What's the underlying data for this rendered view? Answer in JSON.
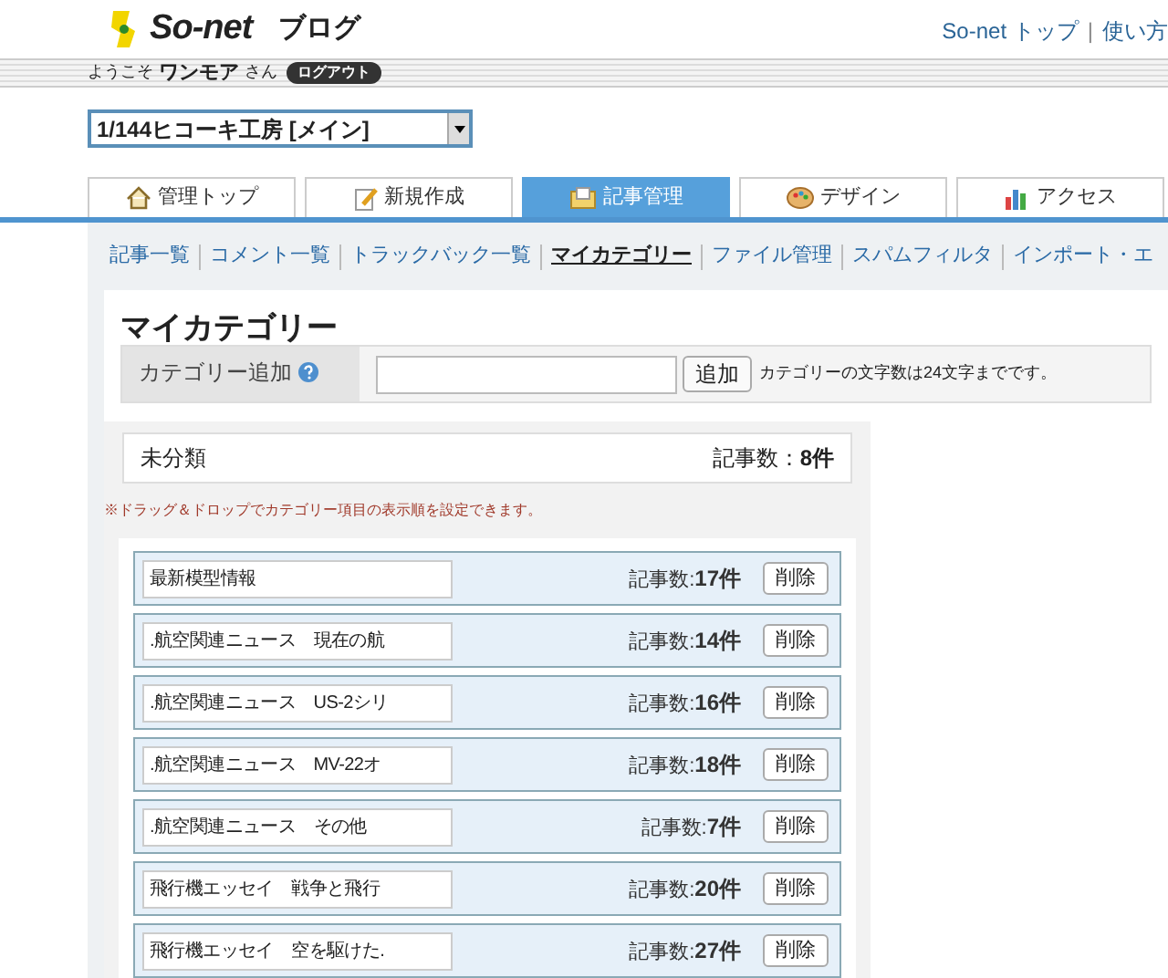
{
  "header": {
    "brand": "So-net",
    "product": "ブログ",
    "links": [
      "So-net トップ",
      "使い方"
    ],
    "link_separator": "|",
    "welcome": "ようこそ",
    "user": "ワンモア",
    "honorific": "さん",
    "logout": "ログアウト"
  },
  "blog_select": {
    "value": "1/144ヒコーキ工房 [メイン]"
  },
  "tabs": [
    {
      "label": "管理トップ",
      "selected": false
    },
    {
      "label": "新規作成",
      "selected": false
    },
    {
      "label": "記事管理",
      "selected": true
    },
    {
      "label": "デザイン",
      "selected": false
    },
    {
      "label": "アクセス",
      "selected": false
    }
  ],
  "subnav": [
    {
      "label": "記事一覧",
      "selected": false
    },
    {
      "label": "コメント一覧",
      "selected": false
    },
    {
      "label": "トラックバック一覧",
      "selected": false
    },
    {
      "label": "マイカテゴリー",
      "selected": true
    },
    {
      "label": "ファイル管理",
      "selected": false
    },
    {
      "label": "スパムフィルタ",
      "selected": false
    },
    {
      "label": "インポート・エ",
      "selected": false
    }
  ],
  "page_title": "マイカテゴリー",
  "add_category": {
    "label": "カテゴリー追加",
    "button": "追加",
    "note": "カテゴリーの文字数は24文字までです。"
  },
  "uncategorized": {
    "name": "未分類",
    "count_label": "記事数：",
    "count": "8件"
  },
  "drag_note": "※ドラッグ＆ドロップでカテゴリー項目の表示順を設定できます。",
  "categories": [
    {
      "name": "最新模型情報",
      "count_label": "記事数:",
      "count": "17件",
      "delete": "削除"
    },
    {
      "name": ".航空関連ニュース　現在の航",
      "count_label": "記事数:",
      "count": "14件",
      "delete": "削除"
    },
    {
      "name": ".航空関連ニュース　US-2シリ",
      "count_label": "記事数:",
      "count": "16件",
      "delete": "削除"
    },
    {
      "name": ".航空関連ニュース　MV-22オ",
      "count_label": "記事数:",
      "count": "18件",
      "delete": "削除"
    },
    {
      "name": ".航空関連ニュース　その他",
      "count_label": "記事数:",
      "count": "7件",
      "delete": "削除"
    },
    {
      "name": "飛行機エッセイ　戦争と飛行",
      "count_label": "記事数:",
      "count": "20件",
      "delete": "削除"
    },
    {
      "name": "飛行機エッセイ　空を駆けた.",
      "count_label": "記事数:",
      "count": "27件",
      "delete": "削除"
    }
  ]
}
